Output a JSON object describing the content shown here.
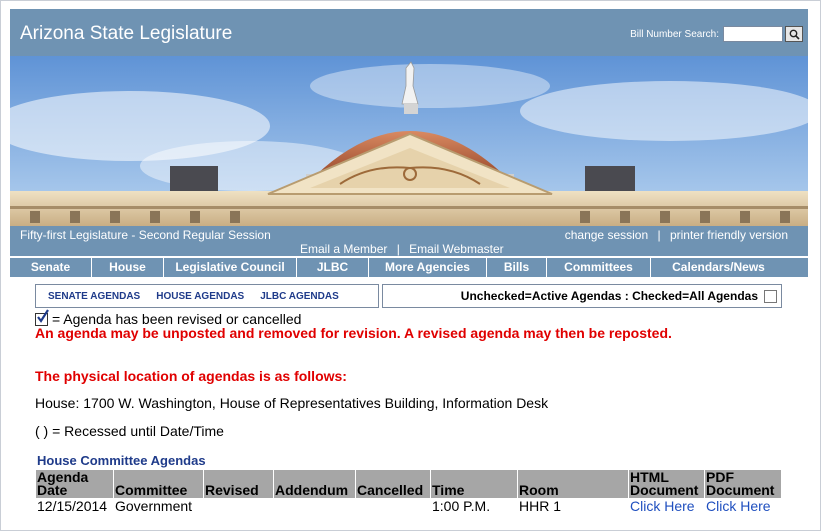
{
  "header": {
    "title": "Arizona State Legislature",
    "bill_search_label": "Bill Number Search:",
    "bill_search_value": ""
  },
  "info": {
    "session_name": "Fifty-first Legislature - Second Regular Session",
    "change_session": "change session",
    "printer_friendly": "printer friendly version",
    "email_member": "Email a Member",
    "email_webmaster": "Email Webmaster",
    "separator": "|"
  },
  "nav": {
    "items": [
      {
        "label": "Senate"
      },
      {
        "label": "House"
      },
      {
        "label": "Legislative Council"
      },
      {
        "label": "JLBC"
      },
      {
        "label": "More Agencies"
      },
      {
        "label": "Bills"
      },
      {
        "label": "Committees"
      },
      {
        "label": "Calendars/News"
      }
    ]
  },
  "agenda_tabs": {
    "senate": "SENATE AGENDAS",
    "house": "HOUSE AGENDAS",
    "jlbc": "JLBC AGENDAS",
    "filter_label": "Unchecked=Active Agendas : Checked=All Agendas"
  },
  "notes": {
    "legend": "= Agenda has been revised or cancelled",
    "warning": "An agenda may be unposted and removed for revision. A revised agenda may then be reposted.",
    "location_heading": "The physical location of agendas is as follows:",
    "location_text": "House: 1700 W. Washington, House of Representatives Building, Information Desk",
    "recess_text": "( ) = Recessed until Date/Time"
  },
  "agendas": {
    "title": "House Committee Agendas",
    "columns": {
      "agenda_date": "Agenda Date",
      "committee": "Committee",
      "revised": "Revised",
      "addendum": "Addendum",
      "cancelled": "Cancelled",
      "time": "Time",
      "room": "Room",
      "html_doc": "HTML Document",
      "pdf_doc": "PDF Document"
    },
    "rows": [
      {
        "agenda_date": "12/15/2014",
        "committee": "Government",
        "revised": "",
        "addendum": "",
        "cancelled": "",
        "time": "1:00 P.M.",
        "room": "HHR 1",
        "html_link": "Click Here",
        "pdf_link": "Click Here"
      }
    ]
  },
  "colors": {
    "header_blue": "#6f93b3",
    "link_blue": "#1f4fbf",
    "warning_red": "#e00000",
    "table_header_gray": "#a6a6a6"
  }
}
